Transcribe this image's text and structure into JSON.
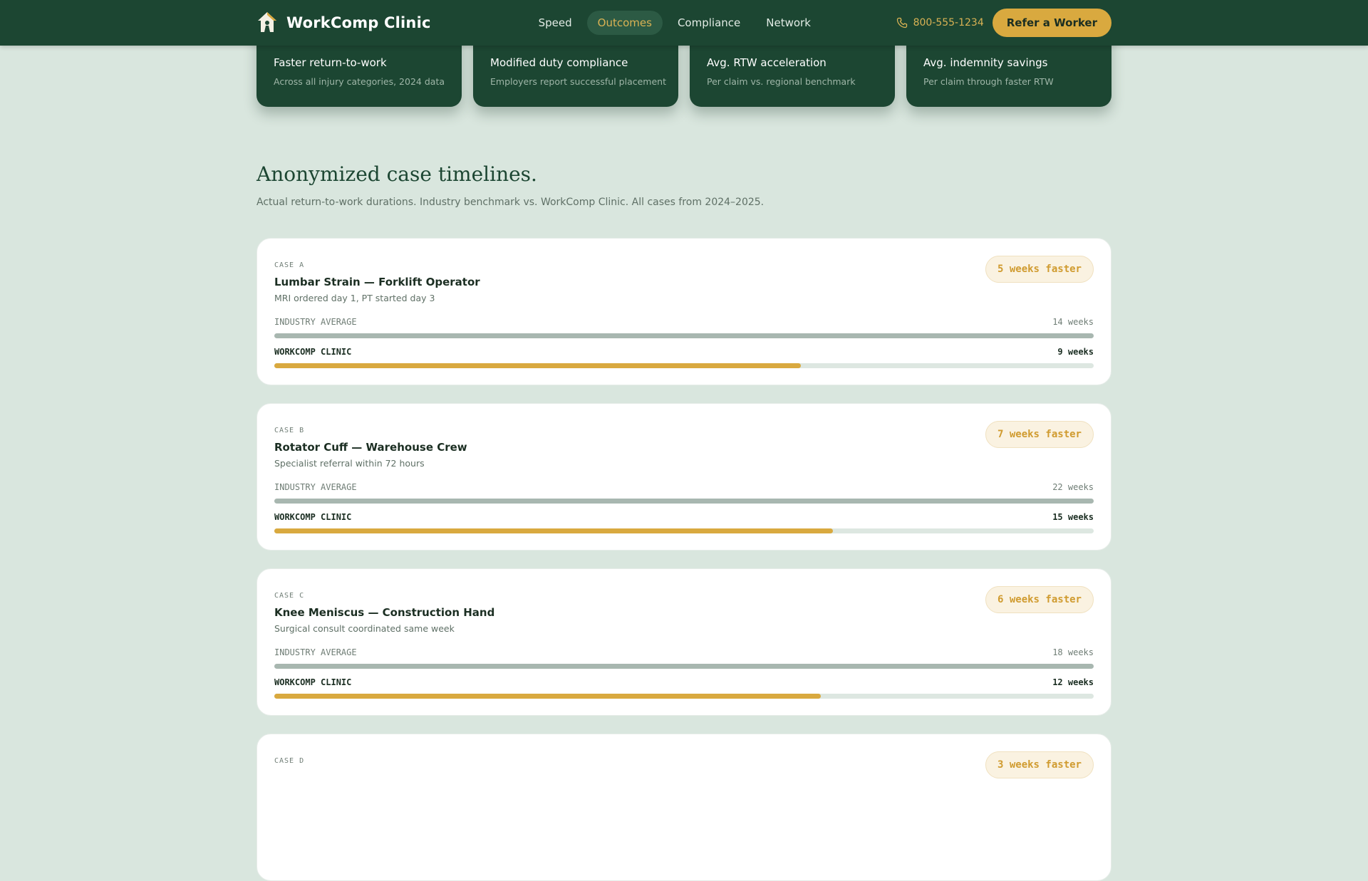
{
  "nav": {
    "brand": "WorkComp Clinic",
    "links": [
      "Speed",
      "Outcomes",
      "Compliance",
      "Network"
    ],
    "active": "Outcomes",
    "phone": "800-555-1234",
    "cta": "Refer a Worker"
  },
  "stats": [
    {
      "label": "Faster return-to-work",
      "sub": "Across all injury categories, 2024 data"
    },
    {
      "label": "Modified duty compliance",
      "sub": "Employers report successful placement"
    },
    {
      "label": "Avg. RTW acceleration",
      "sub": "Per claim vs. regional benchmark"
    },
    {
      "label": "Avg. indemnity savings",
      "sub": "Per claim through faster RTW"
    }
  ],
  "section": {
    "title": "Anonymized case timelines.",
    "subtitle": "Actual return-to-work durations. Industry benchmark vs. WorkComp Clinic. All cases from 2024–2025."
  },
  "labels": {
    "industry": "INDUSTRY AVERAGE",
    "clinic": "WORKCOMP CLINIC"
  },
  "cases": [
    {
      "tag": "CASE A",
      "title": "Lumbar Strain — Forklift Operator",
      "desc": "MRI ordered day 1, PT started day 3",
      "badge": "5 weeks faster",
      "industry": "14 weeks",
      "clinic": "9 weeks",
      "industry_weeks": 14,
      "clinic_weeks": 9
    },
    {
      "tag": "CASE B",
      "title": "Rotator Cuff — Warehouse Crew",
      "desc": "Specialist referral within 72 hours",
      "badge": "7 weeks faster",
      "industry": "22 weeks",
      "clinic": "15 weeks",
      "industry_weeks": 22,
      "clinic_weeks": 15
    },
    {
      "tag": "CASE C",
      "title": "Knee Meniscus — Construction Hand",
      "desc": "Surgical consult coordinated same week",
      "badge": "6 weeks faster",
      "industry": "18 weeks",
      "clinic": "12 weeks",
      "industry_weeks": 18,
      "clinic_weeks": 12
    },
    {
      "tag": "CASE D",
      "badge": "3 weeks faster"
    }
  ],
  "colors": {
    "primary": "#1c4632",
    "accent": "#d9a93f",
    "background": "#d9e6de"
  }
}
